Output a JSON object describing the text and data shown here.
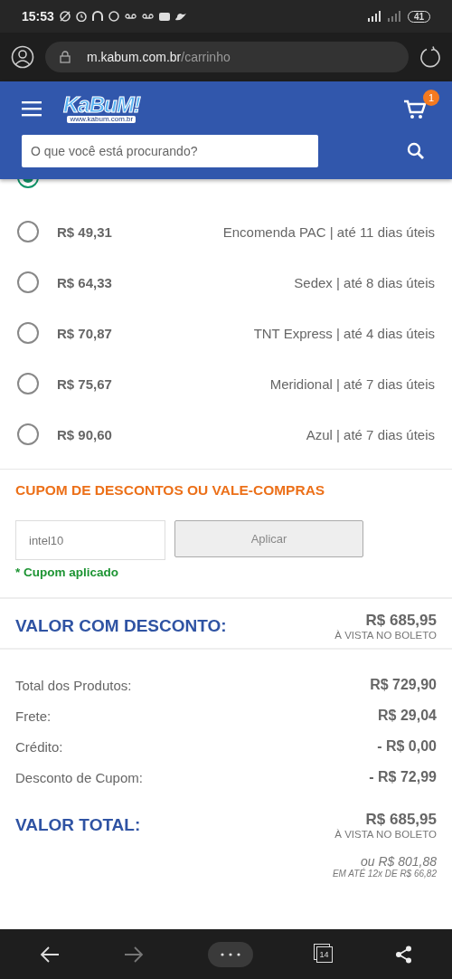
{
  "status_bar": {
    "time": "15:53",
    "battery": "41"
  },
  "browser": {
    "url_host": "m.kabum.com.br",
    "url_path": "/carrinho"
  },
  "header": {
    "logo": "KaBuM!",
    "logo_sub": "www.kabum.com.br",
    "cart_count": "1",
    "search": {
      "placeholder": "O que você está procurando?"
    }
  },
  "shipping_options": [
    {
      "selected": true
    },
    {
      "selected": false,
      "price": "R$ 49,31",
      "carrier": "Encomenda PAC | até 11 dias úteis"
    },
    {
      "selected": false,
      "price": "R$ 64,33",
      "carrier": "Sedex | até 8 dias úteis"
    },
    {
      "selected": false,
      "price": "R$ 70,87",
      "carrier": "TNT Express | até 4 dias úteis"
    },
    {
      "selected": false,
      "price": "R$ 75,67",
      "carrier": "Meridional | até 7 dias úteis"
    },
    {
      "selected": false,
      "price": "R$ 90,60",
      "carrier": "Azul | até 7 dias úteis"
    }
  ],
  "coupon": {
    "title": "CUPOM DE DESCONTOS OU VALE-COMPRAS",
    "value": "intel10",
    "button": "Aplicar",
    "message": "* Cupom aplicado"
  },
  "discount_total": {
    "label": "VALOR COM DESCONTO:",
    "value": "R$ 685,95",
    "note": "À VISTA NO BOLETO"
  },
  "summary": [
    {
      "label": "Total dos Produtos:",
      "value": "R$ 729,90"
    },
    {
      "label": "Frete:",
      "value": "R$ 29,04"
    },
    {
      "label": "Crédito:",
      "value": "- R$ 0,00"
    },
    {
      "label": "Desconto de Cupom:",
      "value": "- R$ 72,99"
    }
  ],
  "total": {
    "label": "VALOR TOTAL:",
    "value": "R$ 685,95",
    "note": "À VISTA NO BOLETO",
    "installment": "ou R$ 801,88",
    "installment_note": "EM ATÉ 12x DE R$ 66,82"
  },
  "bottom_nav": {
    "tabs_count": "14"
  }
}
